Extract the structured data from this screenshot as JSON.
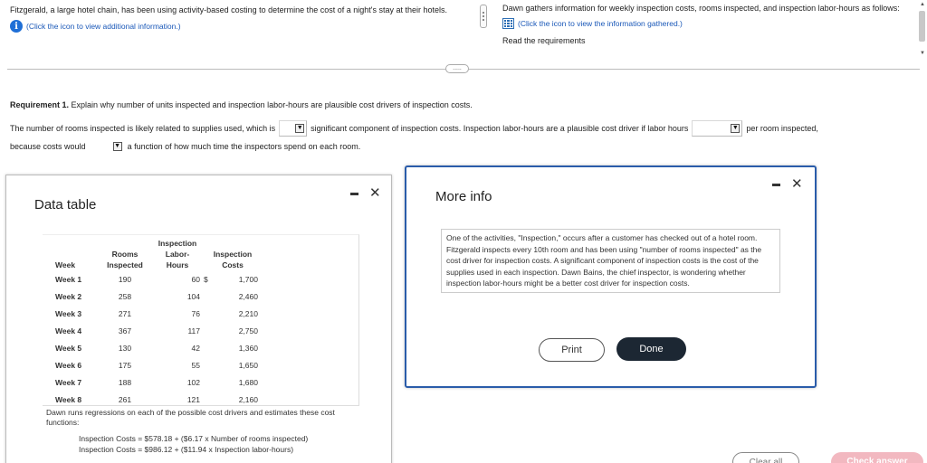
{
  "problem": {
    "left_text": "Fitzgerald, a large hotel chain, has been using activity-based costing to determine the cost of a night's stay at their hotels.",
    "left_link": "(Click the icon to view additional information.)",
    "right_text": "Dawn gathers information for weekly inspection costs, rooms inspected, and inspection labor-hours as follows:",
    "right_link": "(Click the icon to view the information gathered.)",
    "right_cut": "Read the requirements",
    "expander_label": "....."
  },
  "requirement": {
    "label": "Requirement 1.",
    "text": "Explain why number of units inspected and inspection labor-hours are plausible cost drivers of inspection costs."
  },
  "question": {
    "part1": "The number of rooms inspected is likely related to supplies used, which is",
    "part2": "significant component of inspection costs. Inspection labor-hours are a plausible cost driver if labor hours",
    "part3": "per room inspected,",
    "part4": "because costs would",
    "part5": "a function of how much time the inspectors spend on each room."
  },
  "data_table": {
    "title": "Data table",
    "headers": {
      "week": "Week",
      "rooms": [
        "Rooms",
        "Inspected"
      ],
      "hours": [
        "Inspection",
        "Labor-Hours"
      ],
      "costs": [
        "Inspection",
        "Costs"
      ]
    },
    "rows": [
      {
        "week": "Week 1",
        "rooms": "190",
        "hours": "60",
        "dollar": "$",
        "costs": "1,700"
      },
      {
        "week": "Week 2",
        "rooms": "258",
        "hours": "104",
        "dollar": "",
        "costs": "2,460"
      },
      {
        "week": "Week 3",
        "rooms": "271",
        "hours": "76",
        "dollar": "",
        "costs": "2,210"
      },
      {
        "week": "Week 4",
        "rooms": "367",
        "hours": "117",
        "dollar": "",
        "costs": "2,750"
      },
      {
        "week": "Week 5",
        "rooms": "130",
        "hours": "42",
        "dollar": "",
        "costs": "1,360"
      },
      {
        "week": "Week 6",
        "rooms": "175",
        "hours": "55",
        "dollar": "",
        "costs": "1,650"
      },
      {
        "week": "Week 7",
        "rooms": "188",
        "hours": "102",
        "dollar": "",
        "costs": "1,680"
      },
      {
        "week": "Week 8",
        "rooms": "261",
        "hours": "121",
        "dollar": "",
        "costs": "2,160"
      }
    ],
    "regression_intro": "Dawn runs regressions on each of the possible cost drivers and estimates these cost functions:",
    "equation1": "Inspection Costs = $578.18 + ($6.17 x Number of rooms inspected)",
    "equation2": "Inspection Costs = $986.12 + ($11.94 x Inspection labor-hours)"
  },
  "more_info": {
    "title": "More info",
    "text": "One of the activities, \"Inspection,\" occurs after a customer has checked out of a hotel room. Fitzgerald inspects every 10th room and has been using \"number of rooms inspected\" as the cost driver for inspection costs. A significant component of inspection costs is the cost of the supplies used in each inspection. Dawn Bains, the chief inspector, is wondering whether inspection labor-hours might be a better cost driver for inspection costs.",
    "print_label": "Print",
    "done_label": "Done"
  },
  "footer": {
    "clear_all": "Clear all",
    "check_answer": "Check answer"
  },
  "colors": {
    "accent_blue": "#1f6fd6",
    "modal_border": "#2a5caa",
    "done_button": "#1c2733",
    "check_answer": "#f2b8c0"
  }
}
